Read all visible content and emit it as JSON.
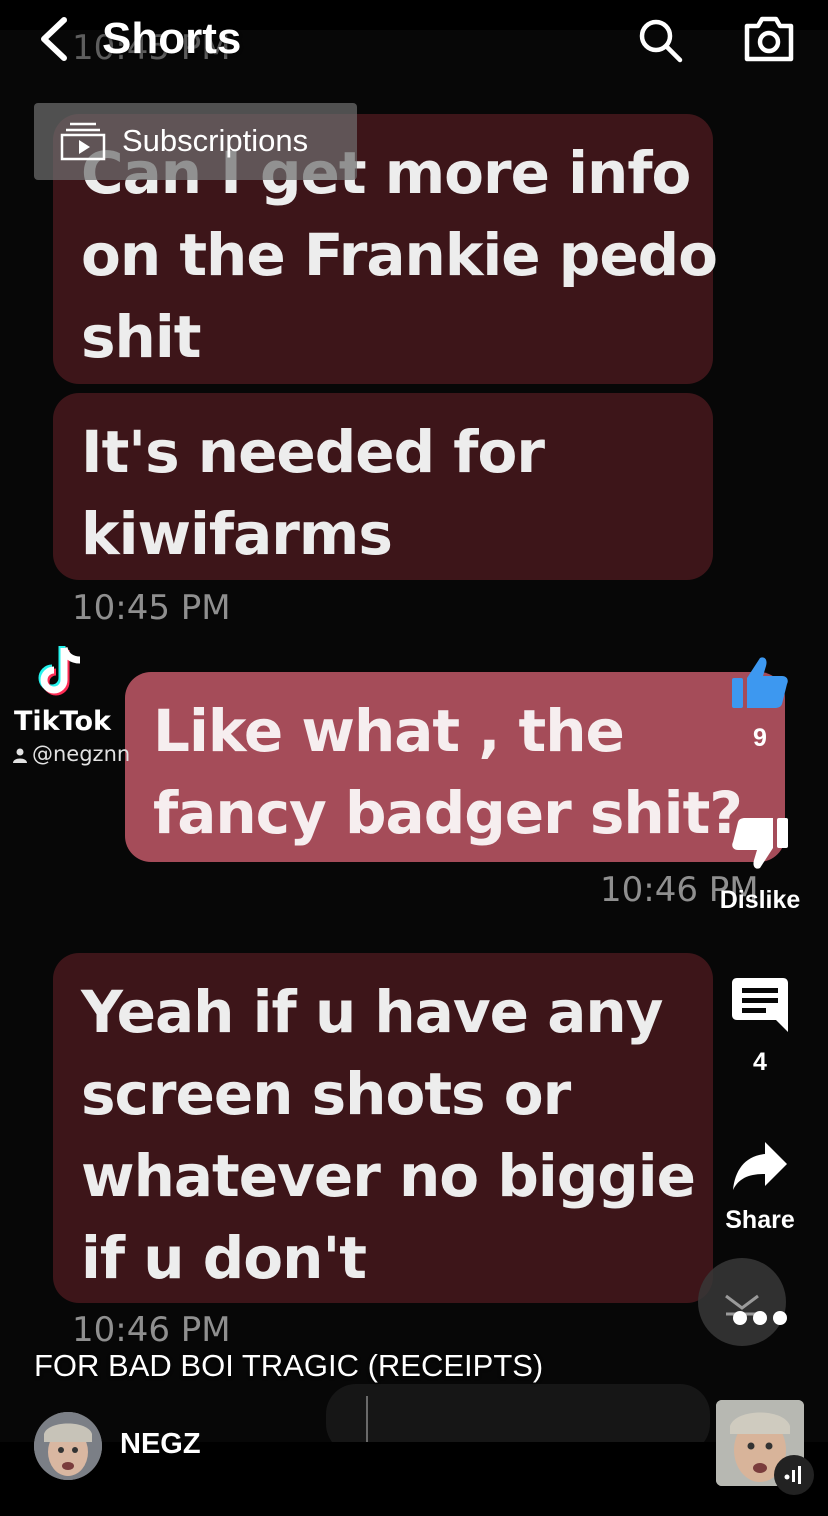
{
  "topbar": {
    "title": "Shorts"
  },
  "subscriptions": {
    "label": "Subscriptions"
  },
  "messages": [
    {
      "direction": "incoming",
      "lines": [
        "Can I get more info",
        "on the Frankie pedo",
        "shit"
      ]
    },
    {
      "direction": "incoming",
      "lines": [
        "It's needed for",
        "kiwifarms"
      ]
    },
    {
      "direction": "outgoing",
      "lines": [
        "Like what , the",
        "fancy badger shit?"
      ]
    },
    {
      "direction": "incoming",
      "lines": [
        "Yeah if u have any",
        "screen shots or",
        "whatever no biggie",
        "if u don't"
      ]
    }
  ],
  "timestamps": {
    "top_partial": "10:45 PM",
    "after_second": "10:45 PM",
    "after_outgoing": "10:46 PM",
    "after_last": "10:46 PM"
  },
  "watermark": {
    "brand": "TikTok",
    "handle": "@negznn"
  },
  "actions": {
    "like_count": "9",
    "dislike_label": "Dislike",
    "comment_count": "4",
    "share_label": "Share"
  },
  "caption": "FOR BAD BOI TRAGIC (RECEIPTS)",
  "channel": {
    "name": "NEGZ"
  },
  "icons": {
    "back": "chevron-left-icon",
    "search": "search-icon",
    "camera": "camera-icon",
    "subscriptions": "subscriptions-icon",
    "like": "thumbs-up-icon",
    "dislike": "thumbs-down-icon",
    "comment": "comment-icon",
    "share": "share-arrow-icon",
    "more": "more-dots-icon"
  },
  "colors": {
    "incoming_bubble": "#3d1519",
    "outgoing_bubble": "#a54c59",
    "like_active": "#3d98f0"
  }
}
